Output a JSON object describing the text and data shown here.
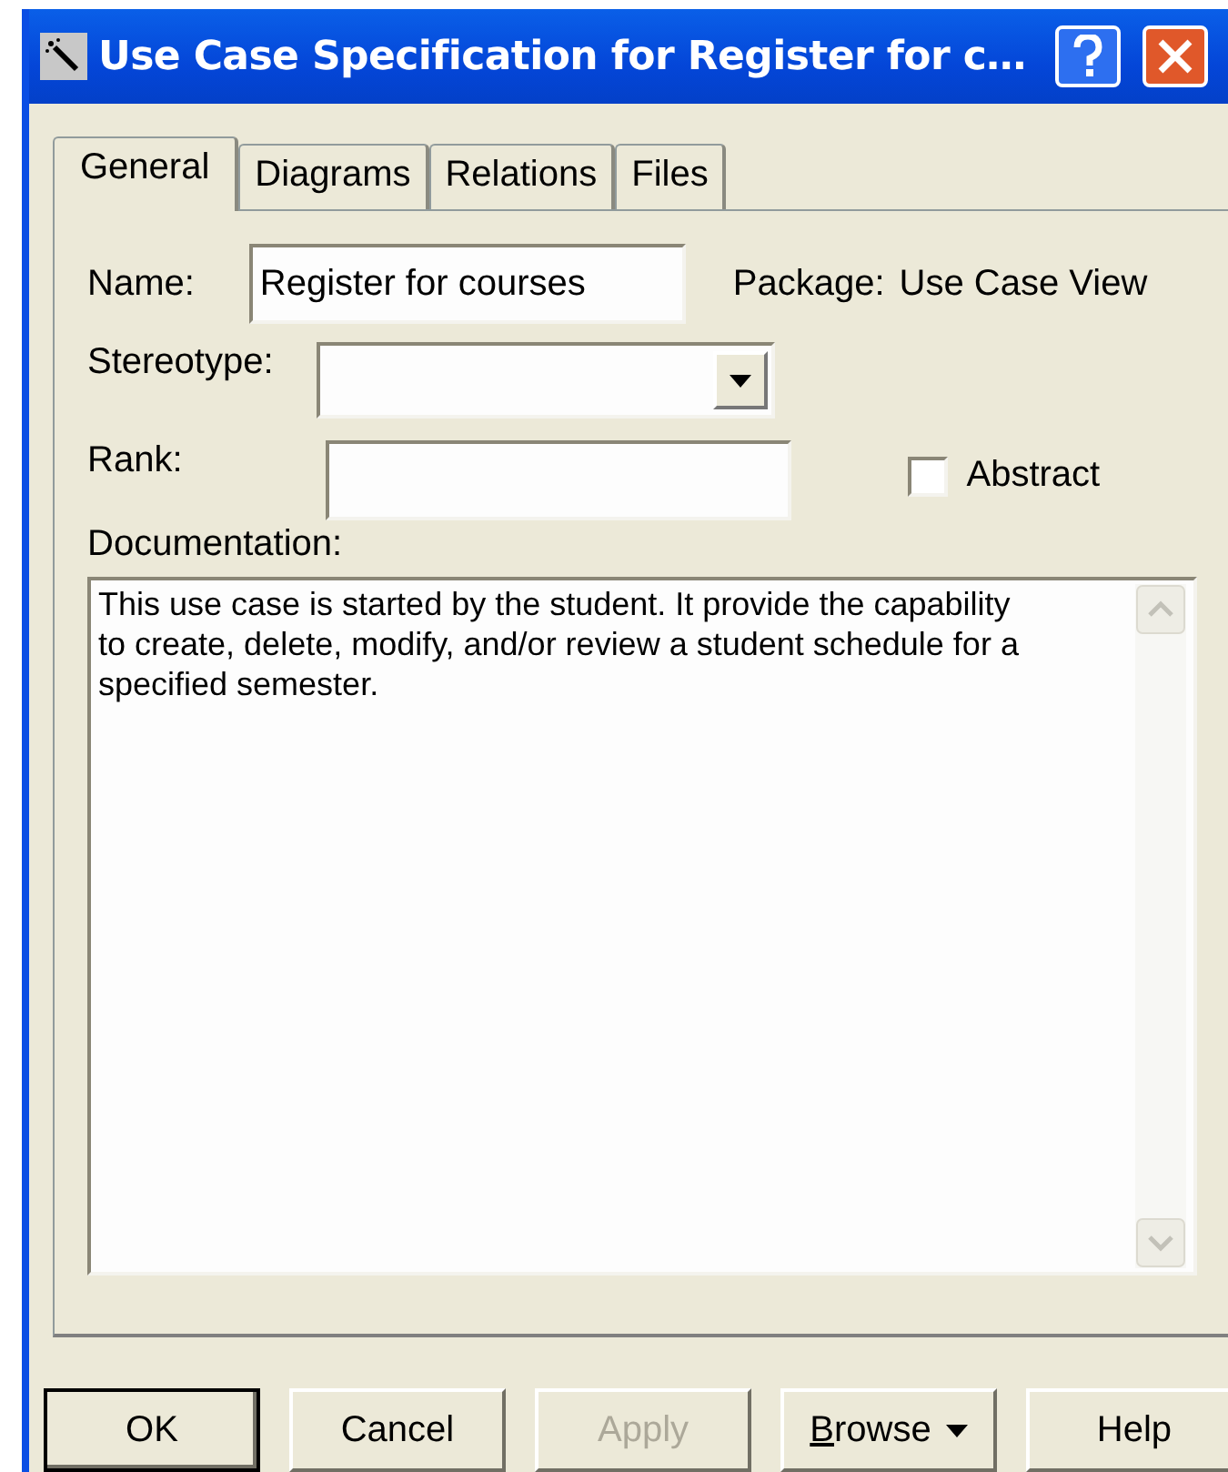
{
  "window": {
    "title": "Use Case Specification for Register for c…"
  },
  "tabs": [
    {
      "label": "General",
      "selected": true
    },
    {
      "label": "Diagrams",
      "selected": false
    },
    {
      "label": "Relations",
      "selected": false
    },
    {
      "label": "Files",
      "selected": false
    }
  ],
  "name": {
    "label": "Name:",
    "value": "Register for courses"
  },
  "package": {
    "label": "Package:",
    "value": "Use Case View"
  },
  "stereotype": {
    "label": "Stereotype:"
  },
  "rank": {
    "label": "Rank:"
  },
  "abstract": {
    "label": "Abstract",
    "checked": false
  },
  "documentation": {
    "label": "Documentation:",
    "value": "This use case is started by the student. It provide the capability to create, delete, modify, and/or review a student schedule for a specified semester."
  },
  "buttons": [
    {
      "label": "OK",
      "default": true,
      "disabled": false,
      "menu": false,
      "mnemonic": false
    },
    {
      "label": "Cancel",
      "default": false,
      "disabled": false,
      "menu": false,
      "mnemonic": false
    },
    {
      "label": "Apply",
      "default": false,
      "disabled": true,
      "menu": false,
      "mnemonic": false
    },
    {
      "label": "Browse",
      "default": false,
      "disabled": false,
      "menu": true,
      "mnemonic": true
    },
    {
      "label": "Help",
      "default": false,
      "disabled": false,
      "menu": false,
      "mnemonic": false
    }
  ]
}
